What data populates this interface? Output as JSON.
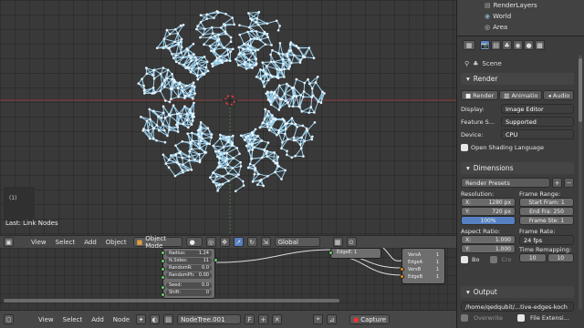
{
  "viewport": {
    "last_op": "Last: Link Nodes",
    "frame_num": "(1)"
  },
  "view_toolbar": {
    "view": "View",
    "select": "Select",
    "add": "Add",
    "object": "Object",
    "mode": "Object Mode",
    "orientation": "Global"
  },
  "node_editor": {
    "node1": {
      "rows": [
        {
          "k": "Radius:",
          "v": "1.24"
        },
        {
          "k": "N.Sides:",
          "v": "11"
        },
        {
          "k": "RandomR:",
          "v": "0.0"
        },
        {
          "k": "RandomPh:",
          "v": "0.00"
        },
        {
          "k": "Seed:",
          "v": "0.0"
        },
        {
          "k": "Shift:",
          "v": "0"
        }
      ]
    },
    "node2": {
      "title": "EdgeE: 1"
    },
    "node3": {
      "rows": [
        {
          "k": "VersA",
          "v": "1"
        },
        {
          "k": "EdgeA",
          "v": "1"
        },
        {
          "k": "VersB",
          "v": "1"
        },
        {
          "k": "EdgeB",
          "v": "1"
        }
      ]
    }
  },
  "node_toolbar": {
    "view": "View",
    "select": "Select",
    "add": "Add",
    "node": "Node",
    "tree_name": "NodeTree.001",
    "capture": "Capture"
  },
  "outliner": {
    "items": [
      "RenderLayers",
      "World",
      "Area"
    ]
  },
  "props": {
    "scene_label": "Scene",
    "render": {
      "header": "Render",
      "render_btn": "Render",
      "anim_btn": "Animatio",
      "audio_btn": "Audio",
      "display_label": "Display:",
      "display_value": "Image Editor",
      "feature_label": "Feature S...",
      "feature_value": "Supported",
      "device_label": "Device:",
      "device_value": "CPU",
      "osl_label": "Open Shading Language"
    },
    "dimensions": {
      "header": "Dimensions",
      "presets": "Render Presets",
      "resolution": "Resolution:",
      "res_x": "1280 px",
      "res_y": "720 px",
      "res_pct": "100%",
      "frame_range": "Frame Range:",
      "start": "Start Fram: 1",
      "end": "End Fra: 250",
      "step": "Frame Ste: 1",
      "aspect": "Aspect Ratio:",
      "asp_x": "1.000",
      "asp_y": "1.000",
      "frame_rate": "Frame Rate:",
      "fps": "24 fps",
      "remap": "Time Remapping:",
      "remap_a": "10",
      "remap_b": "10",
      "bo": "Bo",
      "cro": "Cro"
    },
    "output": {
      "header": "Output",
      "path": "/home/qedqubit/...tive-edges-koch",
      "overwrite": "Overwrite",
      "file_ext": "File Extensi..."
    }
  }
}
